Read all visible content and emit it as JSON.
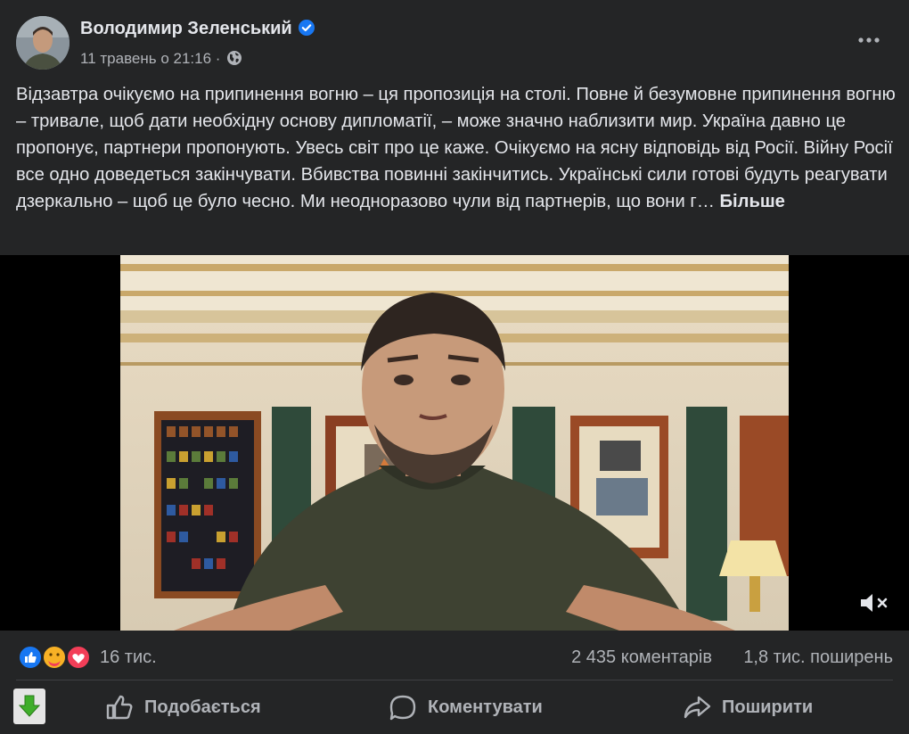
{
  "post": {
    "author": "Володимир Зеленський",
    "timestamp": "11 травень о 21:16 ·",
    "text": "Відзавтра очікуємо на припинення вогню – ця пропозиція на столі. Повне й безумовне припинення вогню – тривале, щоб дати необхідну основу дипломатії, – може значно наблизити мир. Україна давно це пропонує, партнери пропонують. Увесь світ про це каже. Очікуємо на ясну відповідь від Росії. Війну Росії все одно доведеться закінчувати. Вбивства повинні закінчитись. Українські сили готові будуть реагувати дзеркально – щоб це було чесно. Ми неодноразово чули від партнерів, що вони г… ",
    "see_more": "Більше"
  },
  "icons": {
    "verified": "verified-badge-icon",
    "privacy": "globe-icon",
    "options": "more-options-icon",
    "mute": "speaker-muted-icon",
    "like": "like-icon",
    "comment": "comment-icon",
    "share": "share-icon",
    "extension": "download-arrow-icon"
  },
  "stats": {
    "reactions_count": "16 тис.",
    "comments_count": "2 435 коментарів",
    "shares_count": "1,8 тис. поширень"
  },
  "actions": {
    "like": "Подобається",
    "comment": "Коментувати",
    "share": "Поширити"
  },
  "colors": {
    "background": "#242526",
    "text": "#e4e6eb",
    "secondary_text": "#b0b3b8",
    "verified": "#1877f2",
    "like_reaction": "#1877f2",
    "love_reaction": "#f33e58",
    "care_reaction": "#f7b125"
  }
}
